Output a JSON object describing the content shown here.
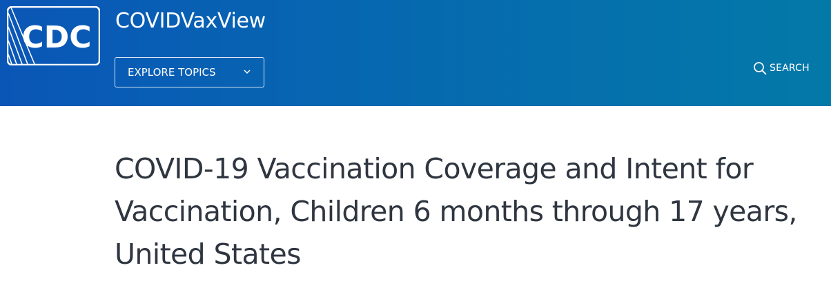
{
  "header": {
    "logo_text": "CDC",
    "site_title": "COVIDVaxView",
    "explore_button_label": "EXPLORE TOPICS",
    "search_label": "SEARCH",
    "background_colors": [
      "#0a56b7",
      "#0479a8"
    ]
  },
  "main": {
    "page_title": "COVID-19 Vaccination Coverage and Intent for Vaccination, Children 6 months through 17 years, United States"
  },
  "icons": {
    "explore_button": "chevron-down-icon",
    "search": "search-icon"
  }
}
